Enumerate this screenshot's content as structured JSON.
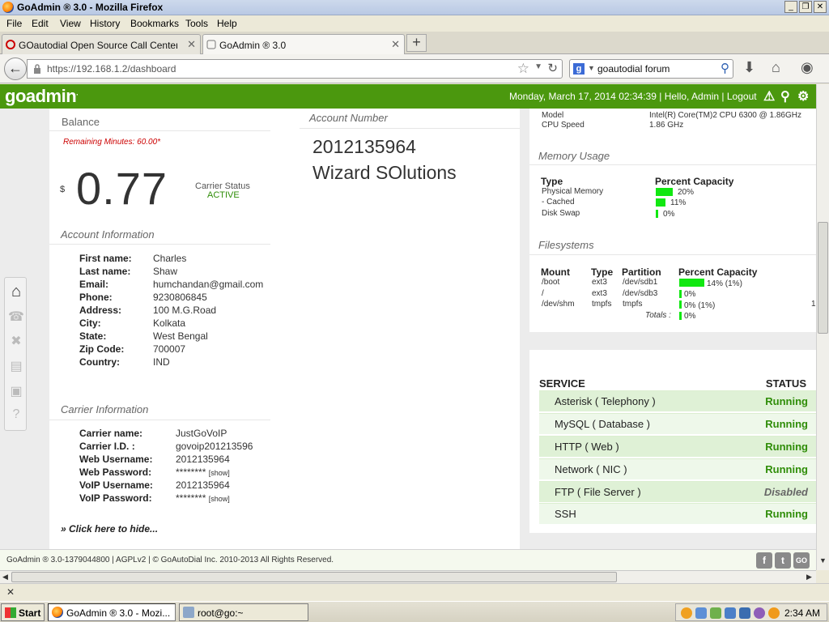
{
  "window": {
    "title": "GoAdmin ® 3.0 - Mozilla Firefox",
    "min": "_",
    "max": "❐",
    "close": "✕"
  },
  "menu": [
    "File",
    "Edit",
    "View",
    "History",
    "Bookmarks",
    "Tools",
    "Help"
  ],
  "tabs": [
    {
      "label": "GOautodial Open Source Call Center Suit...",
      "close": "✕"
    },
    {
      "label": "GoAdmin ® 3.0",
      "close": "✕"
    }
  ],
  "newtab": "+",
  "nav": {
    "url": "https://192.168.1.2/dashboard",
    "search": "goautodial forum"
  },
  "header": {
    "logo": "goadmin",
    "datetime": "Monday, March 17, 2014 02:34:39",
    "greeting": "Hello, Admin",
    "logout": "Logout"
  },
  "balance": {
    "title": "Balance",
    "remaining": "Remaining Minutes: 60.00*",
    "currency": "$",
    "amount": "0.77",
    "carrier_status_label": "Carrier Status",
    "carrier_status": "ACTIVE"
  },
  "account_number": {
    "title": "Account Number",
    "number": "2012135964",
    "company": "Wizard SOlutions"
  },
  "account_info": {
    "title": "Account Information",
    "fields": [
      {
        "label": "First name:",
        "value": "Charles"
      },
      {
        "label": "Last name:",
        "value": "Shaw"
      },
      {
        "label": "Email:",
        "value": "humchandan@gmail.com"
      },
      {
        "label": "Phone:",
        "value": "9230806845"
      },
      {
        "label": "Address:",
        "value": "100 M.G.Road"
      },
      {
        "label": "City:",
        "value": "Kolkata"
      },
      {
        "label": "State:",
        "value": "West Bengal"
      },
      {
        "label": "Zip Code:",
        "value": "700007"
      },
      {
        "label": "Country:",
        "value": "IND"
      }
    ]
  },
  "carrier_info": {
    "title": "Carrier Information",
    "fields": [
      {
        "label": "Carrier name:",
        "value": "JustGoVoIP"
      },
      {
        "label": "Carrier I.D. :",
        "value": "govoip201213596"
      },
      {
        "label": "Web Username:",
        "value": "2012135964"
      },
      {
        "label": "Web Password:",
        "value": "********",
        "show": "[show]"
      },
      {
        "label": "VoIP Username:",
        "value": "2012135964"
      },
      {
        "label": "VoIP Password:",
        "value": "********",
        "show": "[show]"
      }
    ],
    "hide_link": "» Click here to hide..."
  },
  "system": {
    "model_label": "Model",
    "model": "Intel(R) Core(TM)2 CPU 6300 @ 1.86GHz",
    "cpu_label": "CPU Speed",
    "cpu": "1.86 GHz"
  },
  "memory": {
    "title": "Memory Usage",
    "col_type": "Type",
    "col_capacity": "Percent Capacity",
    "rows": [
      {
        "type": "Physical Memory",
        "percent": 20,
        "label": "20%"
      },
      {
        "type": "- Cached",
        "percent": 11,
        "label": "11%"
      },
      {
        "type": "Disk Swap",
        "percent": 0,
        "label": "0%"
      }
    ]
  },
  "filesystems": {
    "title": "Filesystems",
    "cols": [
      "Mount",
      "Type",
      "Partition",
      "Percent Capacity"
    ],
    "rows": [
      {
        "mount": "/boot",
        "type": "ext3",
        "partition": "/dev/sdb1",
        "percent": 14,
        "label": "14% (1%)"
      },
      {
        "mount": "/",
        "type": "ext3",
        "partition": "/dev/sdb3",
        "percent": 0,
        "label": "0%"
      },
      {
        "mount": "/dev/shm",
        "type": "tmpfs",
        "partition": "tmpfs",
        "percent": 0,
        "label": "0% (1%)"
      }
    ],
    "totals_label": "Totals :",
    "totals": "0%",
    "cut_off": "1"
  },
  "services": {
    "col_service": "SERVICE",
    "col_status": "STATUS",
    "rows": [
      {
        "name": "Asterisk ( Telephony )",
        "status": "Running"
      },
      {
        "name": "MySQL ( Database )",
        "status": "Running"
      },
      {
        "name": "HTTP ( Web )",
        "status": "Running"
      },
      {
        "name": "Network ( NIC )",
        "status": "Running"
      },
      {
        "name": "FTP ( File Server )",
        "status": "Disabled"
      },
      {
        "name": "SSH",
        "status": "Running"
      }
    ]
  },
  "footer": {
    "text": "GoAdmin ® 3.0-1379044800 | AGPLv2 | © GoAutoDial Inc. 2010-2013 All Rights Reserved."
  },
  "addon": {
    "close": "✕"
  },
  "taskbar": {
    "start": "Start",
    "tasks": [
      "GoAdmin ® 3.0 - Mozi...",
      "root@go:~"
    ],
    "clock": "2:34 AM"
  }
}
